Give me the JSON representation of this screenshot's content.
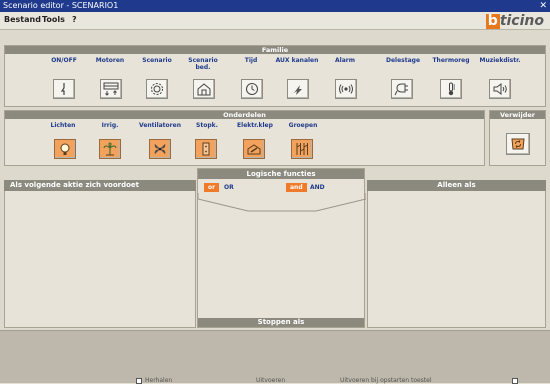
{
  "window": {
    "title": "Scenario editor - SCENARIO1"
  },
  "menu": {
    "items": [
      "Bestand",
      "Tools",
      "?"
    ]
  },
  "brand": {
    "logo_first": "b",
    "logo_rest": "ticino",
    "accent": "#e6781e"
  },
  "familie": {
    "title": "Familie",
    "items": [
      {
        "label": "ON/OFF",
        "icon": "switch-icon"
      },
      {
        "label": "Motoren",
        "icon": "motor-icon"
      },
      {
        "label": "Scenario",
        "icon": "scenario-icon"
      },
      {
        "label": "Scenario bed.",
        "icon": "house-icon"
      },
      {
        "label": "Tijd",
        "icon": "clock-icon"
      },
      {
        "label": "AUX kanalen",
        "icon": "aux-icon"
      },
      {
        "label": "Alarm",
        "icon": "alarm-icon"
      },
      {
        "label": "Delestage",
        "icon": "plug-icon"
      },
      {
        "label": "Thermoreg",
        "icon": "thermometer-icon"
      },
      {
        "label": "Muziekdistr.",
        "icon": "speaker-icon"
      }
    ]
  },
  "onderdelen": {
    "title": "Onderdelen",
    "items": [
      {
        "label": "Lichten",
        "icon": "bulb-icon"
      },
      {
        "label": "Irrig.",
        "icon": "irrigation-icon"
      },
      {
        "label": "Ventilatoren",
        "icon": "fan-icon"
      },
      {
        "label": "Stopk.",
        "icon": "socket-icon"
      },
      {
        "label": "Elektr.klep",
        "icon": "valve-icon"
      },
      {
        "label": "Groepen",
        "icon": "groups-icon"
      }
    ]
  },
  "verwijder": {
    "title": "Verwijder",
    "icon": "recycle-icon"
  },
  "conditions": {
    "left_header": "Als volgende aktie zich voordoet",
    "right_header": "Alleen als",
    "logic_title": "Logische functies",
    "or_chip": "or",
    "or_label": "OR",
    "and_chip": "and",
    "and_label": "AND",
    "stop_label": "Stoppen als"
  },
  "bottom": {
    "options": [
      "Herhalen",
      "Uitvoeren",
      "Uitvoeren bij opstarten toestel"
    ]
  }
}
